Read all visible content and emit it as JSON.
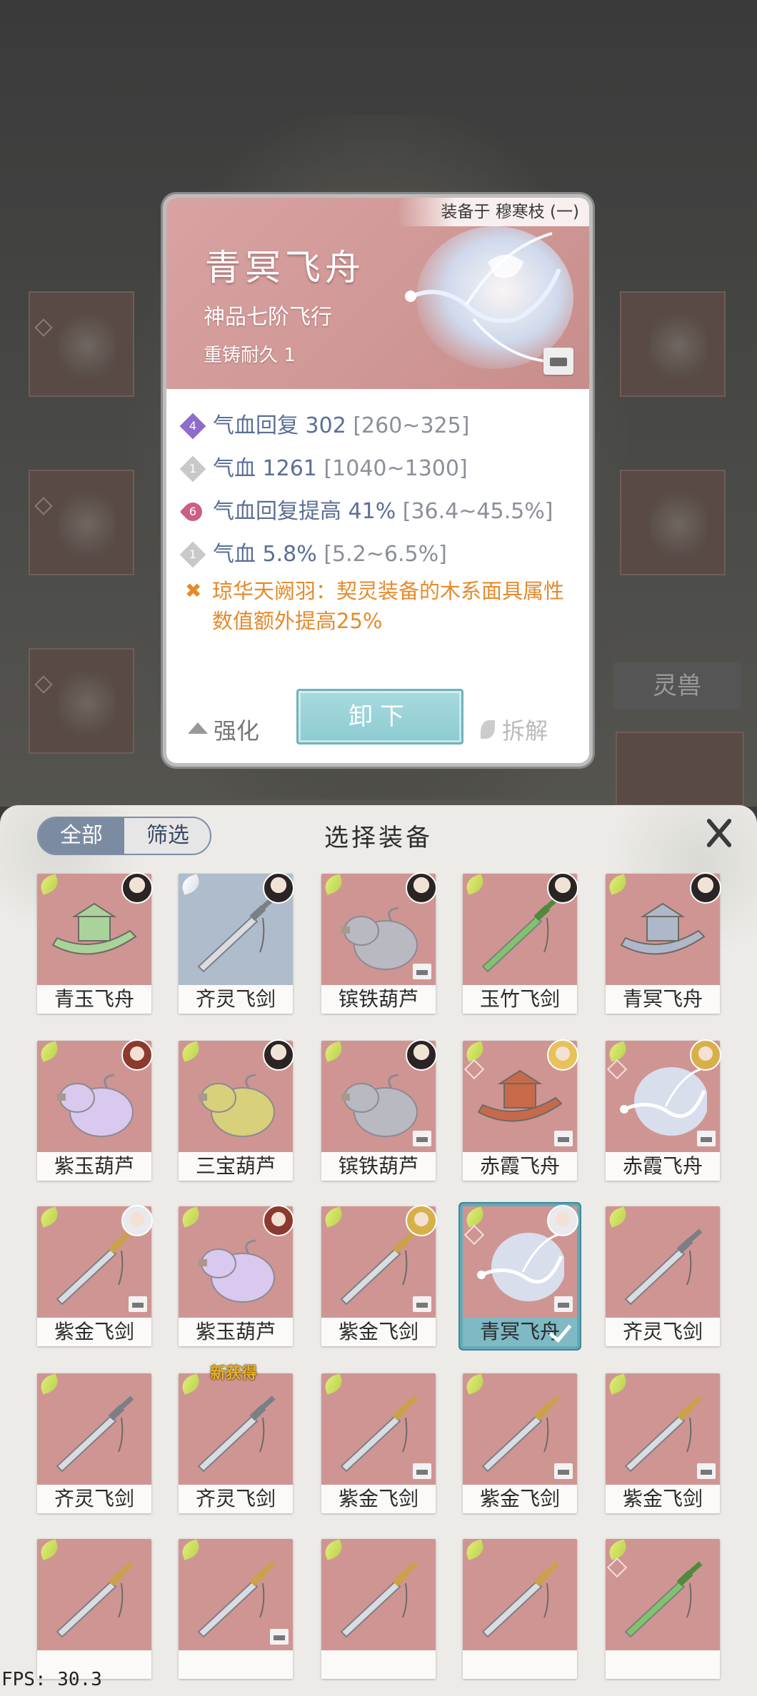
{
  "detail": {
    "equipped_on": "装备于 穆寒枝 (一)",
    "name": "青冥飞舟",
    "grade": "神品七阶飞行",
    "recast": "重铸耐久 1",
    "stats": [
      {
        "badge": "4",
        "badge_color": "#8e6cc9",
        "text": "气血回复 302",
        "range": "[260~325]"
      },
      {
        "badge": "1",
        "badge_color": "#c9c9c9",
        "text": "气血 1261",
        "range": "[1040~1300]"
      },
      {
        "badge": "6",
        "badge_color": "#c9607f",
        "text": "气血回复提高 41%",
        "range": "[36.4~45.5%]"
      },
      {
        "badge": "1",
        "badge_color": "#c9c9c9",
        "text": "气血 5.8%",
        "range": "[5.2~6.5%]"
      }
    ],
    "special_effect": "琼华天阙羽：契灵装备的木系面具属性数值额外提高25%",
    "enhance_label": "强化",
    "unequip_label": "卸下",
    "dismantle_label": "拆解"
  },
  "background": {
    "pet_button": "灵兽"
  },
  "panel": {
    "tab_all": "全部",
    "tab_filter": "筛选",
    "title": "选择装备",
    "items": [
      {
        "name": "青玉飞舟"
      },
      {
        "name": "齐灵飞剑"
      },
      {
        "name": "镔铁葫芦"
      },
      {
        "name": "玉竹飞剑"
      },
      {
        "name": "青冥飞舟"
      },
      {
        "name": "紫玉葫芦"
      },
      {
        "name": "三宝葫芦"
      },
      {
        "name": "镔铁葫芦"
      },
      {
        "name": "赤霞飞舟"
      },
      {
        "name": "赤霞飞舟"
      },
      {
        "name": "紫金飞剑"
      },
      {
        "name": "紫玉葫芦"
      },
      {
        "name": "紫金飞剑"
      },
      {
        "name": "青冥飞舟"
      },
      {
        "name": "齐灵飞剑"
      },
      {
        "name": "齐灵飞剑"
      },
      {
        "name": "齐灵飞剑",
        "tag": "新获得"
      },
      {
        "name": "紫金飞剑"
      },
      {
        "name": "紫金飞剑"
      },
      {
        "name": "紫金飞剑"
      },
      {
        "name": ""
      },
      {
        "name": ""
      },
      {
        "name": ""
      },
      {
        "name": ""
      },
      {
        "name": ""
      }
    ]
  },
  "debug": {
    "fps": "FPS: 30.3"
  }
}
